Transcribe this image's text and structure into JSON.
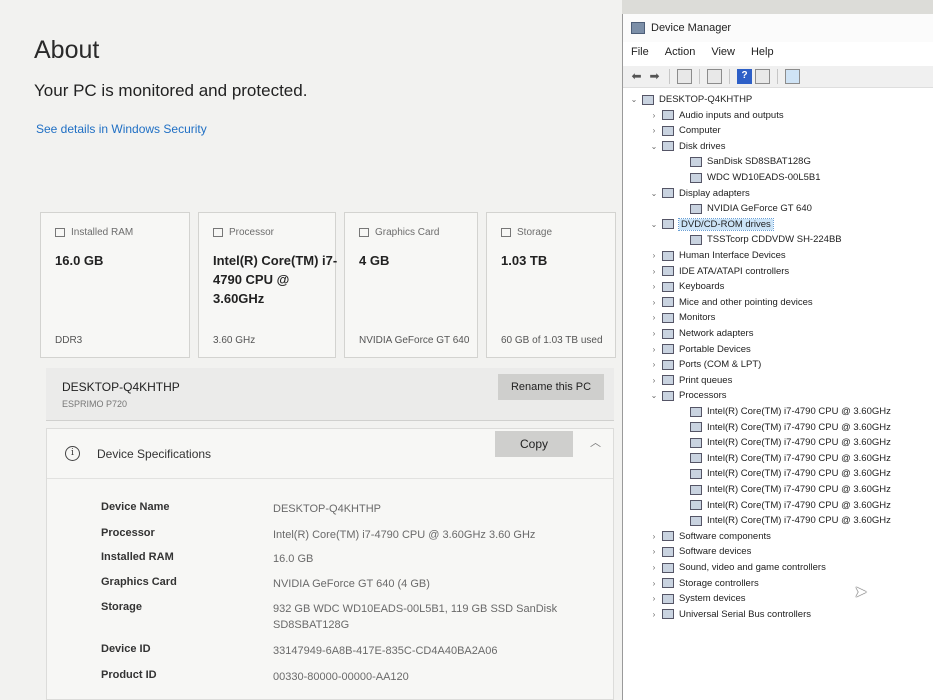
{
  "about": {
    "title": "About",
    "status": "Your PC is monitored and protected.",
    "security_link": "See details in Windows Security",
    "cards": [
      {
        "head": "Installed RAM",
        "value": "16.0 GB",
        "foot": "DDR3",
        "icon": "memory-icon"
      },
      {
        "head": "Processor",
        "value": "Intel(R) Core(TM) i7-4790 CPU @ 3.60GHz",
        "foot": "3.60 GHz",
        "icon": "processor-icon"
      },
      {
        "head": "Graphics Card",
        "value": "4 GB",
        "foot": "NVIDIA GeForce GT 640",
        "icon": "graphics-card-icon"
      },
      {
        "head": "Storage",
        "value": "1.03 TB",
        "foot": "60 GB of 1.03 TB used",
        "icon": "storage-icon"
      }
    ],
    "pc_name": "DESKTOP-Q4KHTHP",
    "pc_model": "ESPRIMO P720",
    "rename_button": "Rename this PC",
    "specs": {
      "title": "Device Specifications",
      "copy_button": "Copy",
      "rows": [
        {
          "label": "Device Name",
          "value": "DESKTOP-Q4KHTHP"
        },
        {
          "label": "Processor",
          "value": "Intel(R) Core(TM) i7-4790 CPU @ 3.60GHz   3.60 GHz"
        },
        {
          "label": "Installed RAM",
          "value": "16.0 GB"
        },
        {
          "label": "Graphics Card",
          "value": "NVIDIA GeForce GT 640 (4 GB)"
        },
        {
          "label": "Storage",
          "value": "932 GB WDC WD10EADS-00L5B1, 119 GB SSD SanDisk SD8SBAT128G"
        },
        {
          "label": "Device ID",
          "value": "33147949-6A8B-417E-835C-CD4A40BA2A06"
        },
        {
          "label": "Product ID",
          "value": "00330-80000-00000-AA120"
        }
      ]
    }
  },
  "device_manager": {
    "title": "Device Manager",
    "menu": [
      "File",
      "Action",
      "View",
      "Help"
    ],
    "tree": [
      {
        "label": "DESKTOP-Q4KHTHP",
        "level": 0,
        "toggle": "v",
        "icon": "computer-icon"
      },
      {
        "label": "Audio inputs and outputs",
        "level": 1,
        "toggle": ">",
        "icon": "speaker-icon"
      },
      {
        "label": "Computer",
        "level": 1,
        "toggle": ">",
        "icon": "monitor-icon"
      },
      {
        "label": "Disk drives",
        "level": 1,
        "toggle": "v",
        "icon": "disk-drive-icon"
      },
      {
        "label": "SanDisk SD8SBAT128G",
        "level": 2,
        "toggle": "",
        "icon": "disk-drive-icon"
      },
      {
        "label": "WDC WD10EADS-00L5B1",
        "level": 2,
        "toggle": "",
        "icon": "disk-drive-icon"
      },
      {
        "label": "Display adapters",
        "level": 1,
        "toggle": "v",
        "icon": "display-adapter-icon"
      },
      {
        "label": "NVIDIA GeForce GT 640",
        "level": 2,
        "toggle": "",
        "icon": "display-adapter-icon"
      },
      {
        "label": "DVD/CD-ROM drives",
        "level": 1,
        "toggle": "v",
        "icon": "dvd-drive-icon",
        "selected": true
      },
      {
        "label": "TSSTcorp CDDVDW SH-224BB",
        "level": 2,
        "toggle": "",
        "icon": "dvd-drive-icon"
      },
      {
        "label": "Human Interface Devices",
        "level": 1,
        "toggle": ">",
        "icon": "hid-icon"
      },
      {
        "label": "IDE ATA/ATAPI controllers",
        "level": 1,
        "toggle": ">",
        "icon": "ide-controller-icon"
      },
      {
        "label": "Keyboards",
        "level": 1,
        "toggle": ">",
        "icon": "keyboard-icon"
      },
      {
        "label": "Mice and other pointing devices",
        "level": 1,
        "toggle": ">",
        "icon": "mouse-icon"
      },
      {
        "label": "Monitors",
        "level": 1,
        "toggle": ">",
        "icon": "monitor-icon"
      },
      {
        "label": "Network adapters",
        "level": 1,
        "toggle": ">",
        "icon": "network-adapter-icon"
      },
      {
        "label": "Portable Devices",
        "level": 1,
        "toggle": ">",
        "icon": "portable-device-icon"
      },
      {
        "label": "Ports (COM & LPT)",
        "level": 1,
        "toggle": ">",
        "icon": "port-icon"
      },
      {
        "label": "Print queues",
        "level": 1,
        "toggle": ">",
        "icon": "printer-icon"
      },
      {
        "label": "Processors",
        "level": 1,
        "toggle": "v",
        "icon": "processor-icon"
      },
      {
        "label": "Intel(R) Core(TM) i7-4790 CPU @ 3.60GHz",
        "level": 2,
        "toggle": "",
        "icon": "processor-icon"
      },
      {
        "label": "Intel(R) Core(TM) i7-4790 CPU @ 3.60GHz",
        "level": 2,
        "toggle": "",
        "icon": "processor-icon"
      },
      {
        "label": "Intel(R) Core(TM) i7-4790 CPU @ 3.60GHz",
        "level": 2,
        "toggle": "",
        "icon": "processor-icon"
      },
      {
        "label": "Intel(R) Core(TM) i7-4790 CPU @ 3.60GHz",
        "level": 2,
        "toggle": "",
        "icon": "processor-icon"
      },
      {
        "label": "Intel(R) Core(TM) i7-4790 CPU @ 3.60GHz",
        "level": 2,
        "toggle": "",
        "icon": "processor-icon"
      },
      {
        "label": "Intel(R) Core(TM) i7-4790 CPU @ 3.60GHz",
        "level": 2,
        "toggle": "",
        "icon": "processor-icon"
      },
      {
        "label": "Intel(R) Core(TM) i7-4790 CPU @ 3.60GHz",
        "level": 2,
        "toggle": "",
        "icon": "processor-icon"
      },
      {
        "label": "Intel(R) Core(TM) i7-4790 CPU @ 3.60GHz",
        "level": 2,
        "toggle": "",
        "icon": "processor-icon"
      },
      {
        "label": "Software components",
        "level": 1,
        "toggle": ">",
        "icon": "software-component-icon"
      },
      {
        "label": "Software devices",
        "level": 1,
        "toggle": ">",
        "icon": "software-device-icon"
      },
      {
        "label": "Sound, video and game controllers",
        "level": 1,
        "toggle": ">",
        "icon": "sound-icon"
      },
      {
        "label": "Storage controllers",
        "level": 1,
        "toggle": ">",
        "icon": "storage-controller-icon"
      },
      {
        "label": "System devices",
        "level": 1,
        "toggle": ">",
        "icon": "system-device-icon"
      },
      {
        "label": "Universal Serial Bus controllers",
        "level": 1,
        "toggle": ">",
        "icon": "usb-icon"
      }
    ]
  },
  "colors": {
    "link": "#1f6fc4",
    "selection": "#cce4f7",
    "toolbar_help": "#2d5fc7"
  }
}
